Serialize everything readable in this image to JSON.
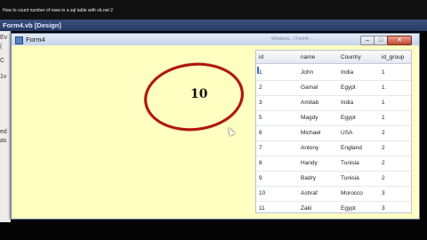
{
  "video": {
    "title": "How to count number of rows in a sql table with vb.net 2"
  },
  "ide": {
    "tab": "Form4.vb [Design]",
    "gutter": [
      "Ev",
      "(",
      "C",
      "1v",
      "ed",
      "as"
    ]
  },
  "window": {
    "title": "Form4",
    "blurred_text": "Windows.. / Form4 ...",
    "buttons": {
      "minimize": "–",
      "maximize": "□",
      "close": "✕"
    }
  },
  "result": {
    "count": "10"
  },
  "grid": {
    "columns": [
      "id",
      "name",
      "Country",
      "id_group"
    ],
    "rows": [
      [
        "1",
        "John",
        "India",
        "1"
      ],
      [
        "2",
        "Gamal",
        "Egypt",
        "1"
      ],
      [
        "3",
        "Amitab",
        "India",
        "1"
      ],
      [
        "5",
        "Magdy",
        "Egypt",
        "1"
      ],
      [
        "6",
        "Michael",
        "USA",
        "2"
      ],
      [
        "7",
        "Antony",
        "England",
        "2"
      ],
      [
        "8",
        "Handy",
        "Tunisia",
        "2"
      ],
      [
        "9",
        "Badry",
        "Tunisia",
        "2"
      ],
      [
        "10",
        "Ashraf",
        "Morocco",
        "3"
      ],
      [
        "11",
        "Zaki",
        "Egypt",
        "3"
      ]
    ]
  },
  "colors": {
    "form_background": "#ffffc2",
    "annotation_circle": "#b0150e",
    "titlebar": "#c4d4ea"
  },
  "icons": [
    "form-icon",
    "mouse-cursor-icon"
  ]
}
